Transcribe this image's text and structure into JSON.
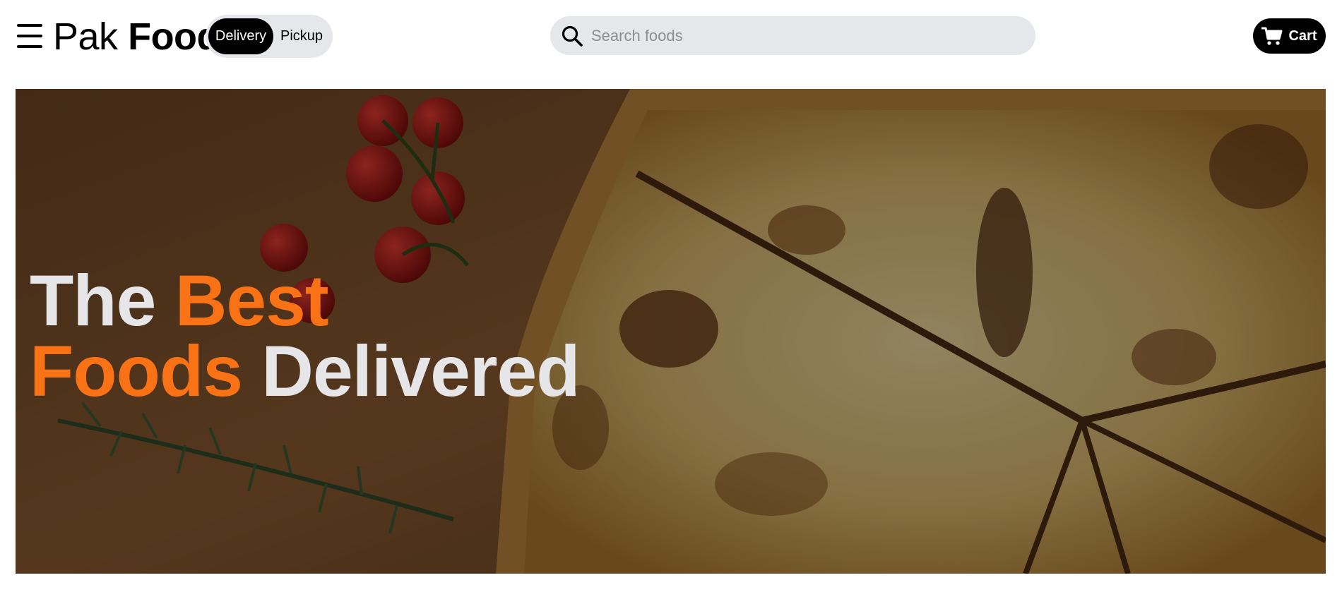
{
  "header": {
    "menu_icon": "hamburger-menu-icon",
    "brand": {
      "light": "Pak",
      "bold": "Food"
    },
    "toggle": {
      "active_label": "Delivery",
      "inactive_label": "Pickup"
    },
    "search": {
      "icon": "search-icon",
      "placeholder": "Search foods",
      "value": ""
    },
    "cart": {
      "icon": "cart-icon",
      "label": "Cart"
    }
  },
  "hero": {
    "line1_white": "The",
    "line1_accent": "Best",
    "line2_accent": "Foods",
    "line2_white": "Delivered",
    "image": "pizza-on-wooden-board-photo"
  },
  "colors": {
    "accent": "#f97316",
    "hero_text": "#e6e6e8",
    "pill_bg": "#e5e7eb",
    "dark": "#000000"
  }
}
